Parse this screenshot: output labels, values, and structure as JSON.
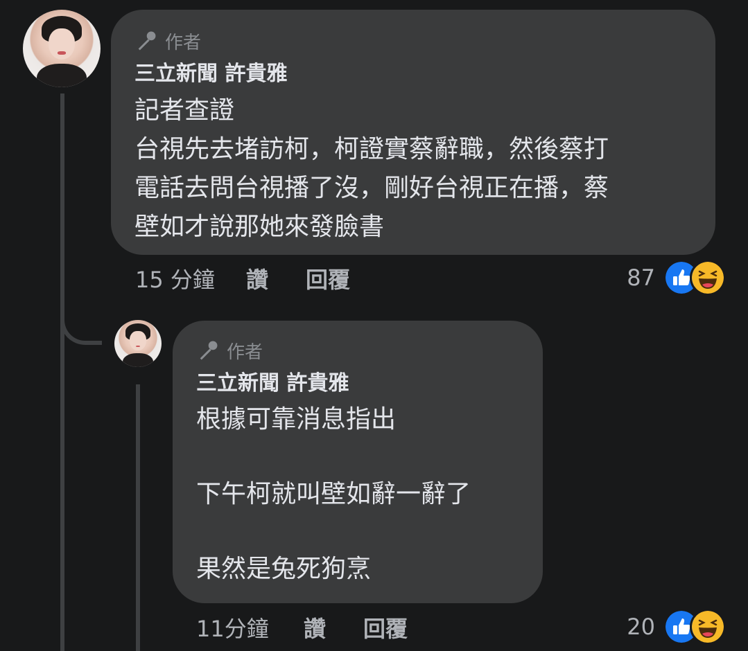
{
  "comments": [
    {
      "author_badge": "作者",
      "author_name": "三立新聞 許貴雅",
      "text": "記者查證\n台視先去堵訪柯，柯證實蔡辭職，然後蔡打\n電話去問台視播了沒，剛好台視正在播，蔡\n壁如才說那她來發臉書",
      "time": "15 分鐘",
      "like_label": "讚",
      "reply_label": "回覆",
      "reaction_count": "87",
      "reaction_icons": [
        "like-icon",
        "haha-icon"
      ]
    },
    {
      "author_badge": "作者",
      "author_name": "三立新聞 許貴雅",
      "text": "根據可靠消息指出\n\n下午柯就叫壁如辭一辭了\n\n果然是兔死狗烹",
      "time": "11分鐘",
      "like_label": "讚",
      "reply_label": "回覆",
      "reaction_count": "20",
      "reaction_icons": [
        "like-icon",
        "haha-icon"
      ]
    }
  ],
  "colors": {
    "background": "#18191a",
    "bubble": "#3a3b3c",
    "primary_text": "#e4e6eb",
    "secondary_text": "#b0b3b8",
    "like_blue": "#1877f2",
    "haha_yellow": "#f7b928"
  }
}
